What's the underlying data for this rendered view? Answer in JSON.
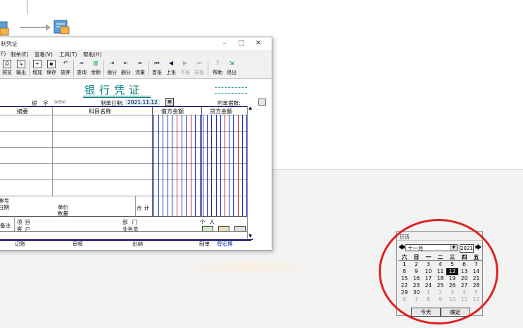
{
  "window": {
    "title": "制凭证",
    "menus": [
      "F)",
      "制单(E)",
      "查看(V)",
      "工具(T)",
      "帮助(H)"
    ],
    "toolbar": [
      {
        "label": "预览",
        "icon": "preview-icon",
        "enabled": true
      },
      {
        "label": "输出",
        "icon": "export-icon",
        "enabled": true
      },
      {
        "label": "增加",
        "icon": "add-icon",
        "enabled": true
      },
      {
        "label": "保存",
        "icon": "save-icon",
        "enabled": true
      },
      {
        "label": "放弃",
        "icon": "undo-icon",
        "enabled": true
      },
      {
        "label": "查询",
        "icon": "binoculars-icon",
        "enabled": true
      },
      {
        "label": "余额",
        "icon": "balance-chart-icon",
        "enabled": true
      },
      {
        "label": "插分",
        "icon": "insert-entry-icon",
        "enabled": true
      },
      {
        "label": "删分",
        "icon": "delete-entry-icon",
        "enabled": true
      },
      {
        "label": "流量",
        "icon": "cashflow-icon",
        "enabled": true
      },
      {
        "label": "首张",
        "icon": "first-icon",
        "enabled": true
      },
      {
        "label": "上张",
        "icon": "prev-icon",
        "enabled": true
      },
      {
        "label": "下张",
        "icon": "next-icon",
        "enabled": false
      },
      {
        "label": "末张",
        "icon": "last-icon",
        "enabled": false
      },
      {
        "label": "帮助",
        "icon": "help-icon",
        "enabled": true
      },
      {
        "label": "退出",
        "icon": "exit-icon",
        "enabled": true
      }
    ]
  },
  "voucher": {
    "title": "银行凭证",
    "type_prefix": "银",
    "number_label": "字",
    "number": "0050",
    "date_label": "制单日期:",
    "date": "2021.11.12",
    "attach_label": "附单据数:",
    "headers": {
      "summary": "摘要",
      "account": "科目名称",
      "debit": "借方金额",
      "credit": "贷方金额"
    },
    "bottom": {
      "bill_no": "票号",
      "date": "日期",
      "unit_price": "单价",
      "quantity": "数量",
      "total": "合计",
      "remark": "备注",
      "project": "项目",
      "customer": "客户",
      "department": "部门",
      "person": "个人",
      "salesperson": "业务员"
    },
    "footer": {
      "posted": "记账",
      "audit": "审核",
      "cashier": "出纳",
      "maker_label": "制单",
      "maker": "曾宏博"
    }
  },
  "calendar": {
    "title": "日历",
    "month": "十一月",
    "year": "2021",
    "weekdays": [
      "六",
      "日",
      "一",
      "二",
      "三",
      "四",
      "五"
    ],
    "days": [
      {
        "d": "1",
        "cur": true
      },
      {
        "d": "2",
        "cur": true
      },
      {
        "d": "3",
        "cur": true
      },
      {
        "d": "4",
        "cur": true
      },
      {
        "d": "5",
        "cur": true
      },
      {
        "d": "6",
        "cur": true
      },
      {
        "d": "7",
        "cur": true
      },
      {
        "d": "8",
        "cur": true
      },
      {
        "d": "9",
        "cur": true
      },
      {
        "d": "10",
        "cur": true
      },
      {
        "d": "11",
        "cur": true
      },
      {
        "d": "12",
        "cur": true,
        "selected": true
      },
      {
        "d": "13",
        "cur": true
      },
      {
        "d": "14",
        "cur": true
      },
      {
        "d": "15",
        "cur": true
      },
      {
        "d": "16",
        "cur": true
      },
      {
        "d": "17",
        "cur": true
      },
      {
        "d": "18",
        "cur": true
      },
      {
        "d": "19",
        "cur": true
      },
      {
        "d": "20",
        "cur": true
      },
      {
        "d": "21",
        "cur": true
      },
      {
        "d": "22",
        "cur": true
      },
      {
        "d": "23",
        "cur": true
      },
      {
        "d": "24",
        "cur": true
      },
      {
        "d": "25",
        "cur": true
      },
      {
        "d": "26",
        "cur": true
      },
      {
        "d": "27",
        "cur": true
      },
      {
        "d": "28",
        "cur": true
      },
      {
        "d": "29",
        "cur": true
      },
      {
        "d": "30",
        "cur": true
      },
      {
        "d": "1",
        "cur": false
      },
      {
        "d": "2",
        "cur": false
      },
      {
        "d": "3",
        "cur": false
      },
      {
        "d": "4",
        "cur": false
      },
      {
        "d": "5",
        "cur": false
      },
      {
        "d": "6",
        "cur": false
      },
      {
        "d": "7",
        "cur": false
      },
      {
        "d": "8",
        "cur": false
      },
      {
        "d": "9",
        "cur": false
      },
      {
        "d": "10",
        "cur": false
      },
      {
        "d": "11",
        "cur": false
      },
      {
        "d": "12",
        "cur": false
      }
    ],
    "today_label": "今天",
    "ok_label": "确定"
  },
  "colors": {
    "voucher_title": "#0b8080",
    "annotation": "#e02020",
    "debit_line": "#1d2bcc",
    "credit_line": "#cc1d1d"
  }
}
